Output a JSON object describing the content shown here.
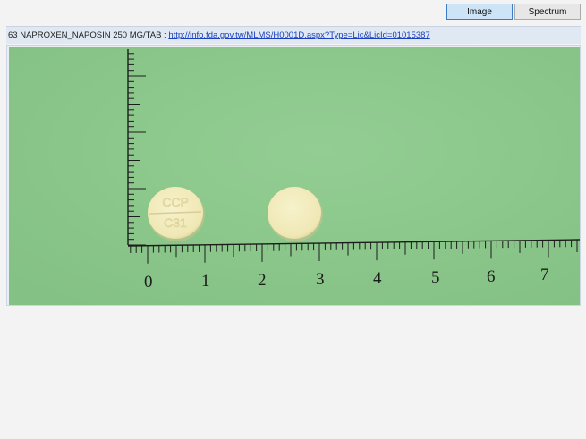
{
  "toolbar": {
    "image_label": "Image",
    "spectrum_label": "Spectrum",
    "active": "Image"
  },
  "info": {
    "title": "63 NAPROXEN_NAPOSIN 250 MG/TAB : ",
    "link_text": "http://info.fda.gov.tw/MLMS/H0001D.aspx?Type=Lic&LicId=01015387"
  },
  "photo": {
    "background_color": "#8cc78c",
    "tablet_color": "#f3edbe",
    "ruler_labels": [
      "0",
      "1",
      "2",
      "3",
      "4",
      "5",
      "6",
      "7"
    ],
    "tablet_imprint": [
      "CCP",
      "C31"
    ]
  }
}
